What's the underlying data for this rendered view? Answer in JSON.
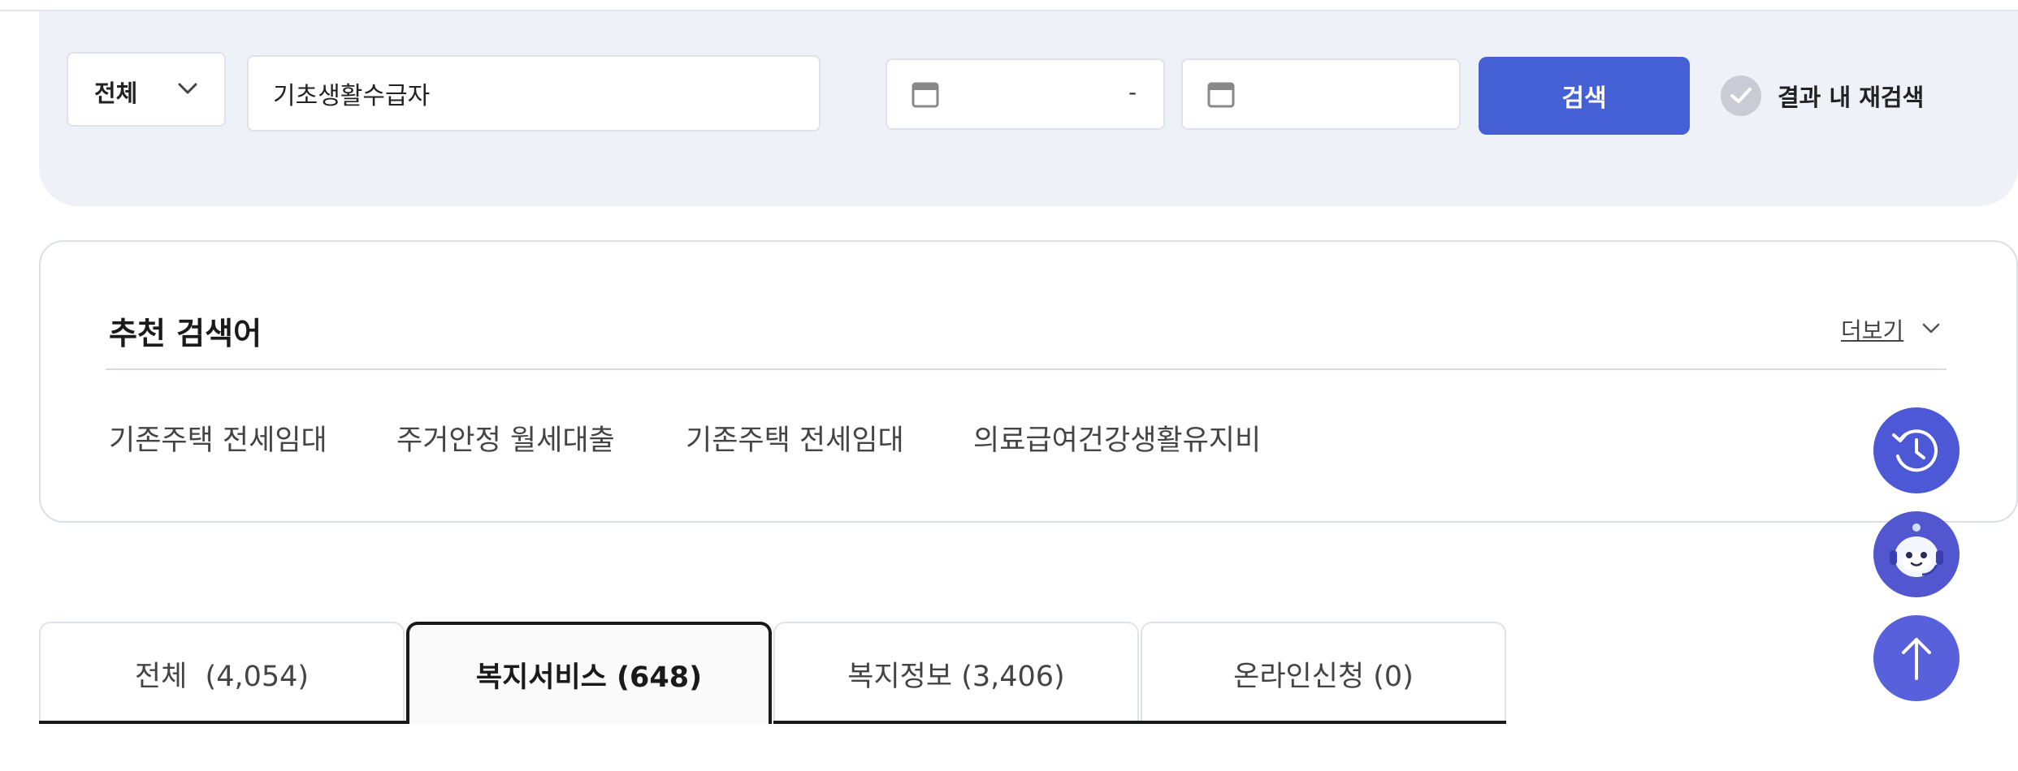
{
  "search": {
    "category_selected": "전체",
    "keyword_value": "기초생활수급자",
    "date_separator": "-",
    "search_button_label": "검색",
    "re_search_label": "결과 내 재검색"
  },
  "recommend": {
    "title": "추천 검색어",
    "more_label": "더보기",
    "items": [
      "기존주택 전세임대",
      "주거안정 월세대출",
      "기존주택 전세임대",
      "의료급여건강생활유지비"
    ]
  },
  "tabs": [
    {
      "label": "전체  (4,054)",
      "active": false
    },
    {
      "label": "복지서비스 (648)",
      "active": true
    },
    {
      "label": "복지정보 (3,406)",
      "active": false
    },
    {
      "label": "온라인신청 (0)",
      "active": false
    }
  ],
  "floating_buttons": [
    "history-icon",
    "chatbot-icon",
    "arrow-up-icon"
  ],
  "colors": {
    "accent": "#4460d4",
    "panel_bg": "#eef1f8",
    "fab": "#4d58d6"
  }
}
